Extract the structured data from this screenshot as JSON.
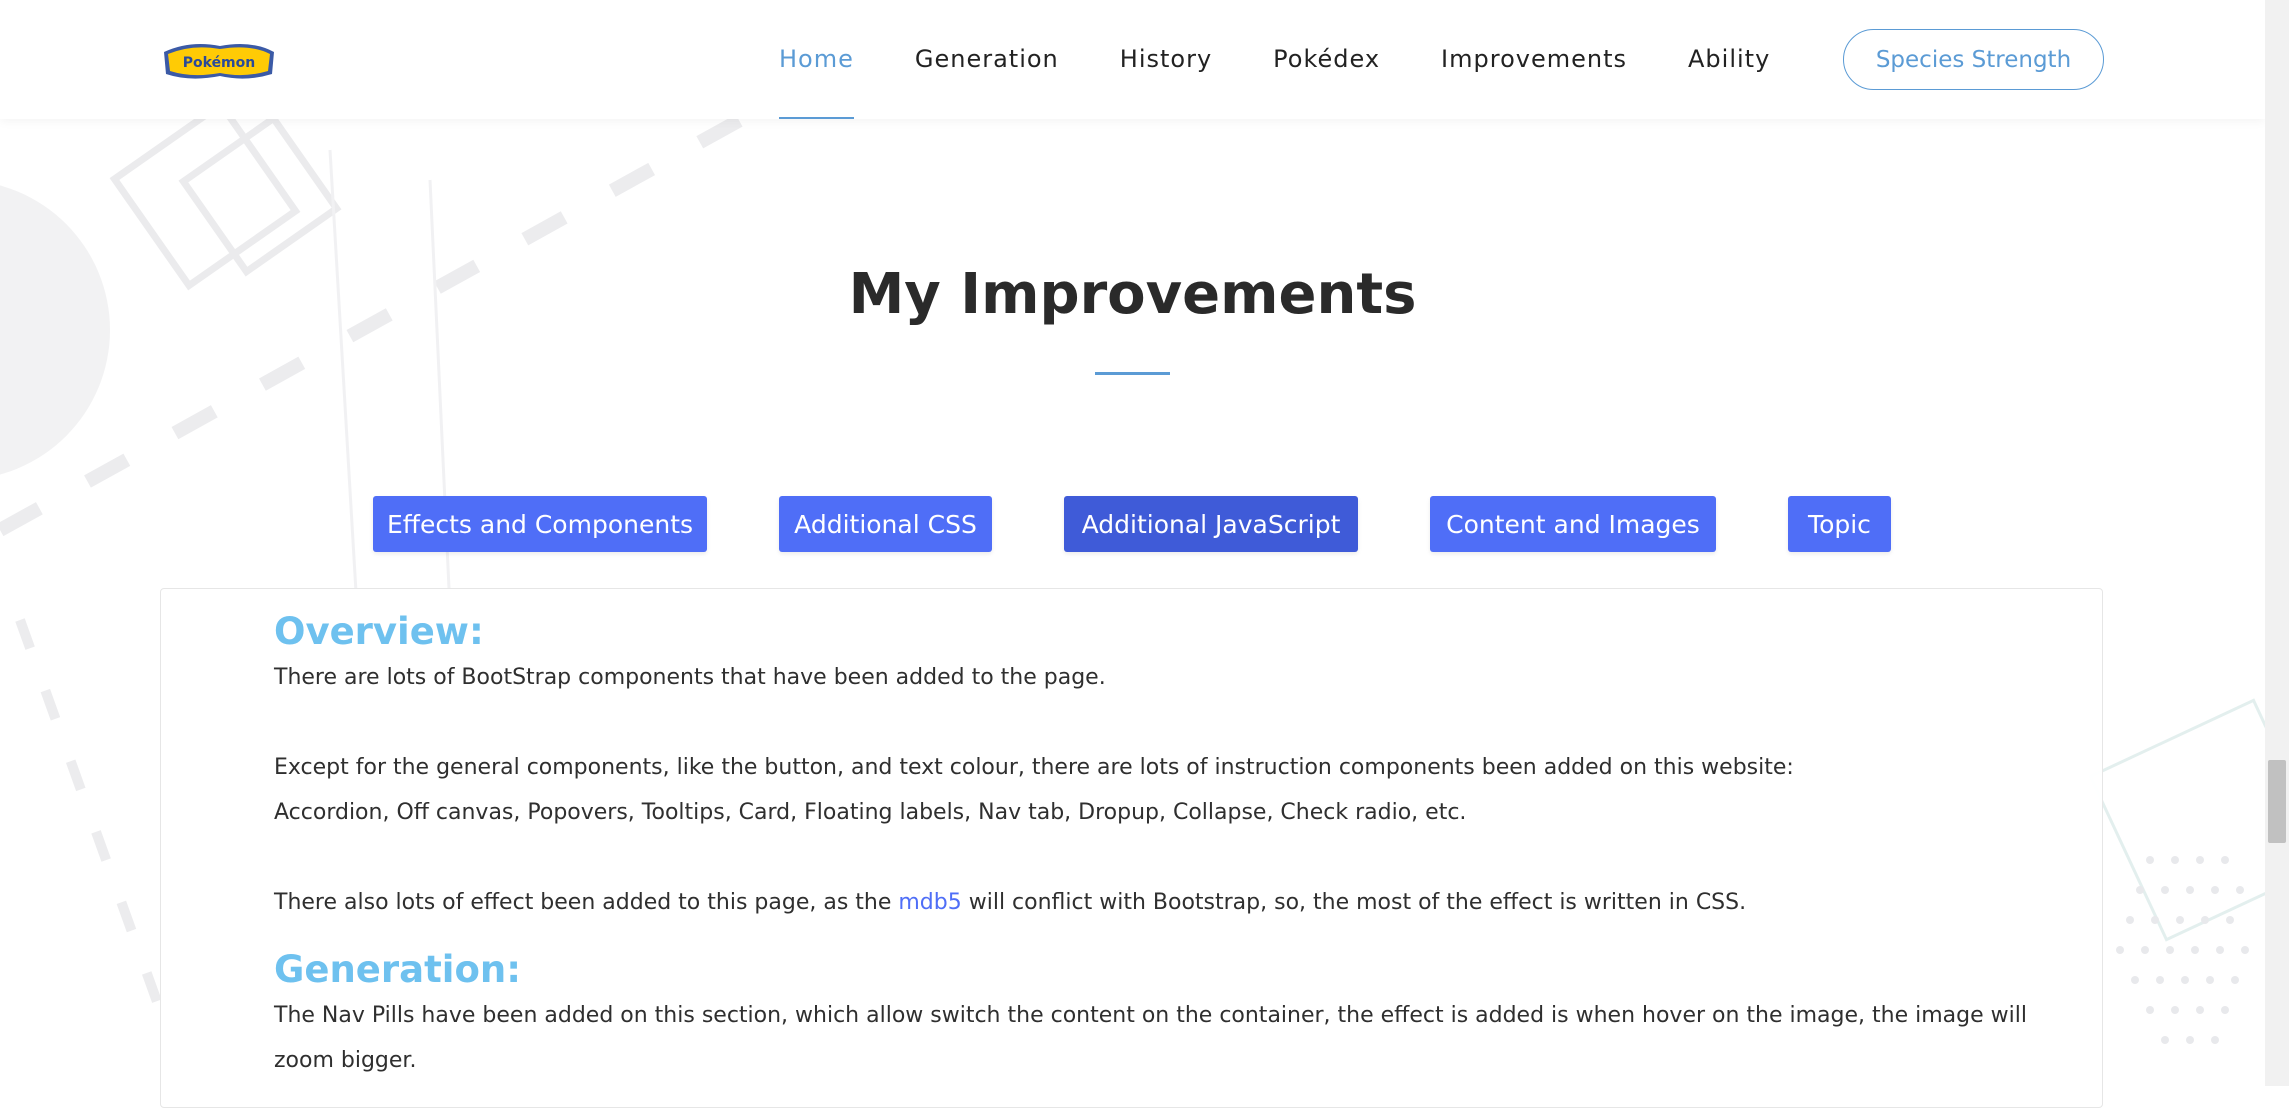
{
  "header": {
    "logo_text": "Pokémon",
    "nav": [
      {
        "label": "Home",
        "active": true
      },
      {
        "label": "Generation",
        "active": false
      },
      {
        "label": "History",
        "active": false
      },
      {
        "label": "Pokédex",
        "active": false
      },
      {
        "label": "Improvements",
        "active": false
      },
      {
        "label": "Ability",
        "active": false
      }
    ],
    "cta_label": "Species Strength"
  },
  "main": {
    "title": "My Improvements",
    "tabs": [
      {
        "label": "Effects and Components",
        "active": false
      },
      {
        "label": "Additional CSS",
        "active": false
      },
      {
        "label": "Additional JavaScript",
        "active": true
      },
      {
        "label": "Content and Images",
        "active": false
      },
      {
        "label": "Topic",
        "active": false
      }
    ],
    "content": {
      "overview_heading": "Overview:",
      "overview_p1": "There are lots of BootStrap components that have been added to the page.",
      "overview_p2a": "Except for the general components, like the button, and text colour, there are lots of instruction components been added on this website:",
      "overview_p2b": "Accordion, Off canvas, Popovers, Tooltips, Card, Floating labels, Nav tab, Dropup, Collapse, Check radio, etc.",
      "overview_p3_before": "There also lots of effect been added to this page, as the ",
      "overview_p3_link": "mdb5",
      "overview_p3_after": " will conflict with Bootstrap, so, the most of the effect is written in CSS.",
      "generation_heading": "Generation:",
      "generation_p1a": "The Nav Pills have been added on this section, which allow switch the content on the container, the effect is added is when hover on the image, the image will",
      "generation_p1b": "zoom bigger."
    }
  },
  "colors": {
    "accent": "#5b9bd5",
    "tab_bg": "#4f6ef7",
    "tab_active_bg": "#3f5bd8",
    "heading": "#6ec1ef",
    "link": "#4f6ef7"
  },
  "icons": {
    "logo": "pokemon-logo"
  }
}
